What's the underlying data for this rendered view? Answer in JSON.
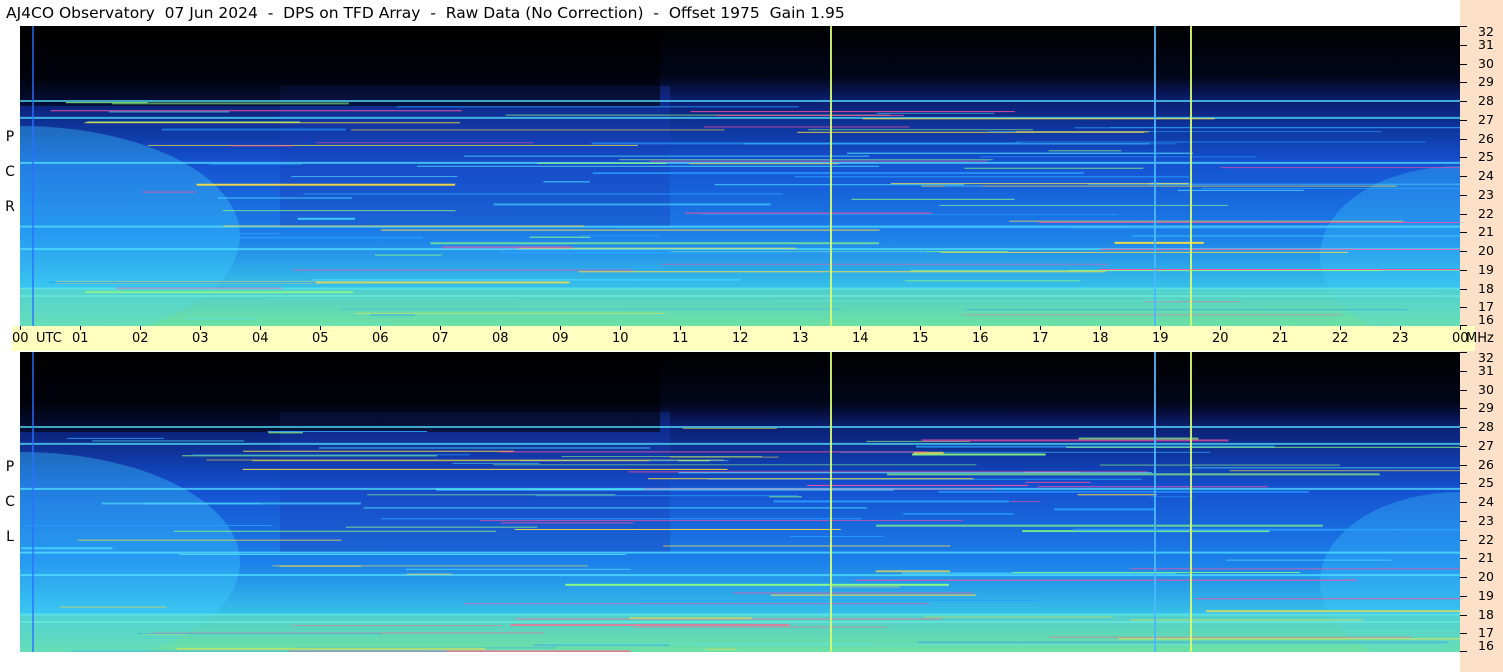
{
  "header": {
    "title": "AJ4CO Observatory  07 Jun 2024  -  DPS on TFD Array  -  Raw Data (No Correction)  -  Offset 1975  Gain 1.95"
  },
  "panels": [
    {
      "label_letters": [
        "R",
        "C",
        "P"
      ]
    },
    {
      "label_letters": [
        "L",
        "C",
        "P"
      ]
    }
  ],
  "time_axis": {
    "labels": [
      "00",
      "01",
      "02",
      "03",
      "04",
      "05",
      "06",
      "07",
      "08",
      "09",
      "10",
      "11",
      "12",
      "13",
      "14",
      "15",
      "16",
      "17",
      "18",
      "19",
      "20",
      "21",
      "22",
      "23",
      "00"
    ],
    "unit": "UTC"
  },
  "freq_axis": {
    "labels": [
      "16",
      "17",
      "18",
      "19",
      "20",
      "21",
      "22",
      "23",
      "24",
      "25",
      "26",
      "27",
      "28",
      "29",
      "30",
      "31",
      "32"
    ],
    "unit": "MHz"
  },
  "colors": {
    "background": "#000000",
    "time_bar": "#ffffc0",
    "freq_bar": "#fde0c8",
    "low": "#0a1a6b",
    "mid": "#1e6fff",
    "high": "#3fe0ff",
    "peak": "#c8ff60"
  },
  "chart_data": {
    "type": "heatmap",
    "title": "AJ4CO Observatory  07 Jun 2024  -  DPS on TFD Array  -  Raw Data (No Correction)  -  Offset 1975  Gain 1.95",
    "x_label": "UTC",
    "y_label": "MHz",
    "x_range": [
      0,
      24
    ],
    "y_range": [
      16,
      32
    ],
    "x_ticks": [
      "00",
      "01",
      "02",
      "03",
      "04",
      "05",
      "06",
      "07",
      "08",
      "09",
      "10",
      "11",
      "12",
      "13",
      "14",
      "15",
      "16",
      "17",
      "18",
      "19",
      "20",
      "21",
      "22",
      "23",
      "00"
    ],
    "y_ticks": [
      16,
      17,
      18,
      19,
      20,
      21,
      22,
      23,
      24,
      25,
      26,
      27,
      28,
      29,
      30,
      31,
      32
    ],
    "panels": [
      "RCP",
      "LCP"
    ],
    "vertical_interference_lines_utc": [
      13.5,
      18.9,
      19.5
    ],
    "persistent_carrier_bands_mhz": [
      17.6,
      18.0,
      20.1,
      21.3,
      24.7,
      27.1,
      28.0
    ]
  }
}
